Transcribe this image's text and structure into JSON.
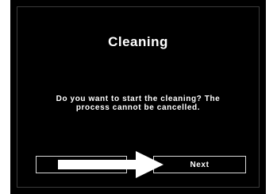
{
  "dialog": {
    "title": "Cleaning",
    "message_line1": "Do you want to start the cleaning? The",
    "message_line2": "process cannot be cancelled.",
    "back_label": "",
    "next_label": "Next"
  },
  "annotation": {
    "arrow_icon": "right-arrow-icon",
    "arrow_color": "#ffffff"
  },
  "colors": {
    "screen_background": "#000000",
    "text": "#ffffff",
    "button_border": "#d8d8d8"
  }
}
